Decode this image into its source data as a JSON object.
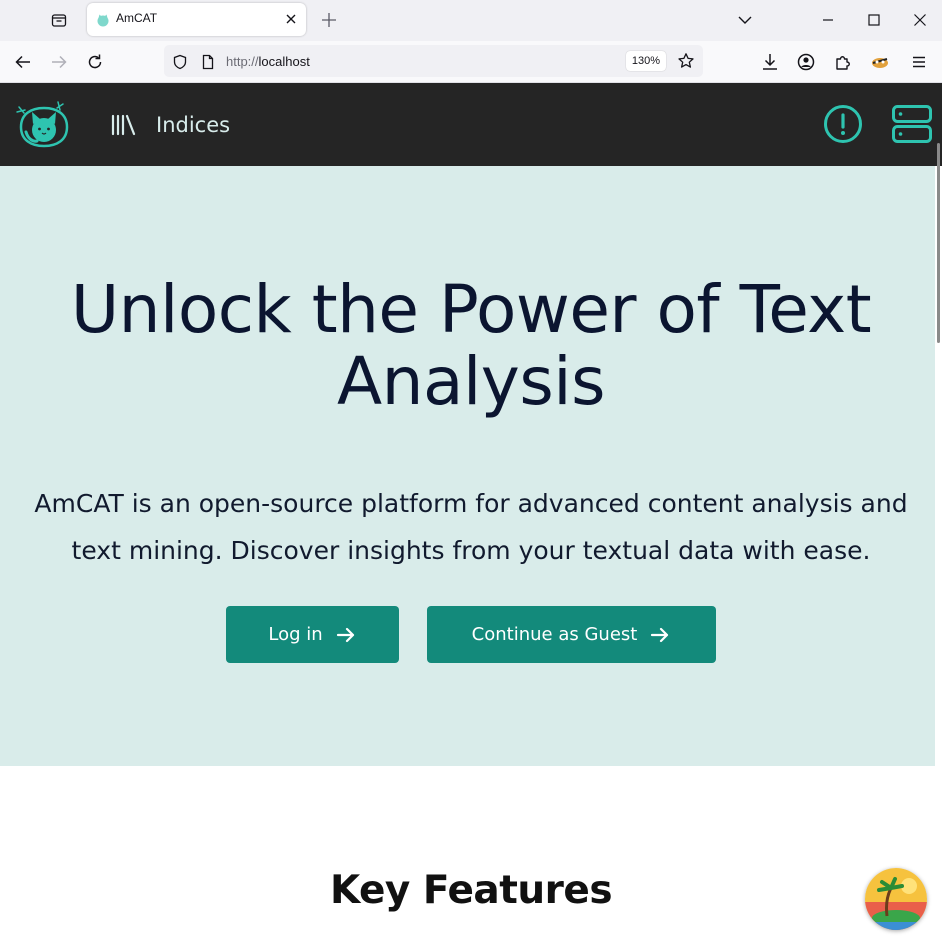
{
  "browser": {
    "tab": {
      "title": "AmCAT",
      "favicon": "amcat-cat-icon"
    },
    "url": {
      "scheme": "http://",
      "host": "localhost"
    },
    "zoom": "130%",
    "icons": [
      "tab-list-icon",
      "close-icon",
      "plus-icon",
      "chevron-down-icon",
      "minimize-icon",
      "maximize-icon",
      "window-close-icon",
      "back-arrow-icon",
      "forward-arrow-icon",
      "reload-icon",
      "shield-icon",
      "page-icon",
      "star-icon",
      "download-icon",
      "account-icon",
      "extensions-icon",
      "addon-icon",
      "menu-icon"
    ]
  },
  "header": {
    "logo": "amcat-cat-logo",
    "nav": {
      "label": "Indices",
      "icon": "library-icon"
    },
    "actions": [
      "alert-circle-icon",
      "server-icon"
    ]
  },
  "hero": {
    "title": "Unlock the Power of Text Analysis",
    "subtitle": "AmCAT is an open-source platform for advanced content analysis and text mining. Discover insights from your textual data with ease.",
    "login_label": "Log in",
    "guest_label": "Continue as Guest"
  },
  "features": {
    "title": "Key Features"
  },
  "colors": {
    "header_bg": "#252525",
    "accent": "#2ec4b0",
    "hero_bg": "#d9ecea",
    "button_bg": "#138a7b",
    "title_text": "#0b1530"
  }
}
